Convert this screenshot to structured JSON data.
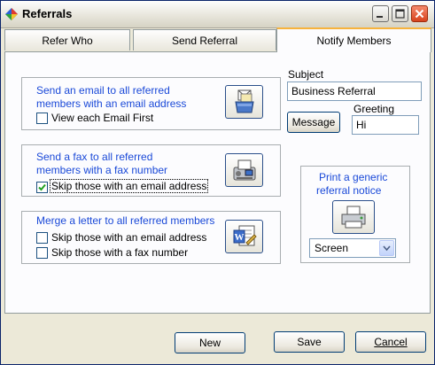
{
  "window": {
    "title": "Referrals"
  },
  "tabs": [
    {
      "label": "Refer Who"
    },
    {
      "label": "Send Referral"
    },
    {
      "label": "Notify Members"
    }
  ],
  "email_group": {
    "line1": "Send an email to all referred",
    "line2": "members with an email address",
    "checkbox_label": "View each Email First",
    "checked": false
  },
  "fax_group": {
    "line1": "Send a fax to all referred",
    "line2": "members with a fax number",
    "checkbox_label": "Skip those with an email address",
    "checked": true
  },
  "letter_group": {
    "line1": "Merge a letter to all referred members",
    "skip_email_label": "Skip those with an email address",
    "skip_email_checked": false,
    "skip_fax_label": "Skip those with a fax number",
    "skip_fax_checked": false
  },
  "subject": {
    "label": "Subject",
    "value": "Business Referral"
  },
  "message_button": "Message",
  "greeting": {
    "label": "Greeting",
    "value": "Hi"
  },
  "print_group": {
    "line1": "Print a generic",
    "line2": "referral notice",
    "output_selected": "Screen"
  },
  "buttons": {
    "new": "New",
    "save": "Save",
    "cancel": "Cancel"
  },
  "colors": {
    "accent_text": "#1a49d8",
    "active_tab_highlight": "#f7b33c",
    "close_button": "#d8431d"
  }
}
